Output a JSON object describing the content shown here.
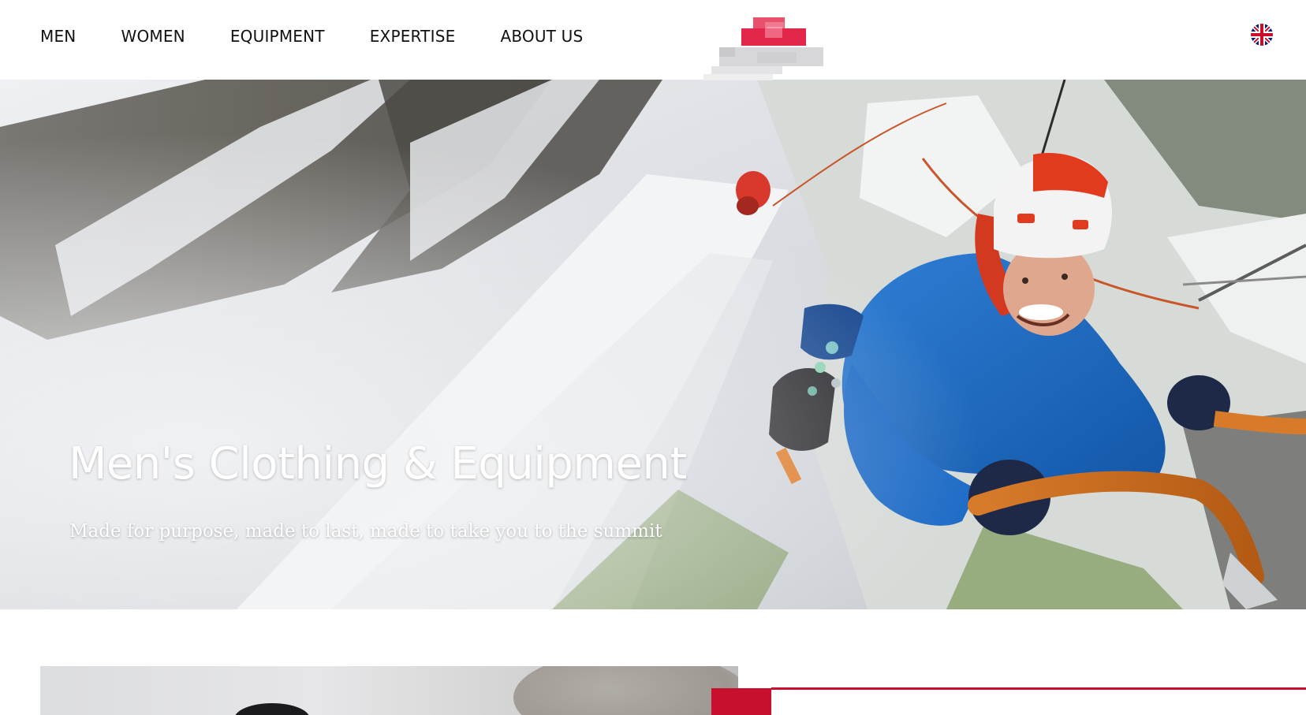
{
  "header": {
    "nav": [
      {
        "label": "MEN"
      },
      {
        "label": "WOMEN"
      },
      {
        "label": "EQUIPMENT"
      },
      {
        "label": "EXPERTISE"
      },
      {
        "label": "ABOUT US"
      }
    ],
    "logo_colors": {
      "primary": "#e2274b",
      "secondary": "#d9d9dc"
    },
    "language_icon": "uk-flag-icon"
  },
  "hero": {
    "title": "Men's Clothing & Equipment",
    "subtitle": "Made for purpose, made to last, made to take you to the summit",
    "image": "ice-climber-photo"
  },
  "colors": {
    "accent": "#c8102e",
    "text": "#111111",
    "background": "#ffffff"
  }
}
